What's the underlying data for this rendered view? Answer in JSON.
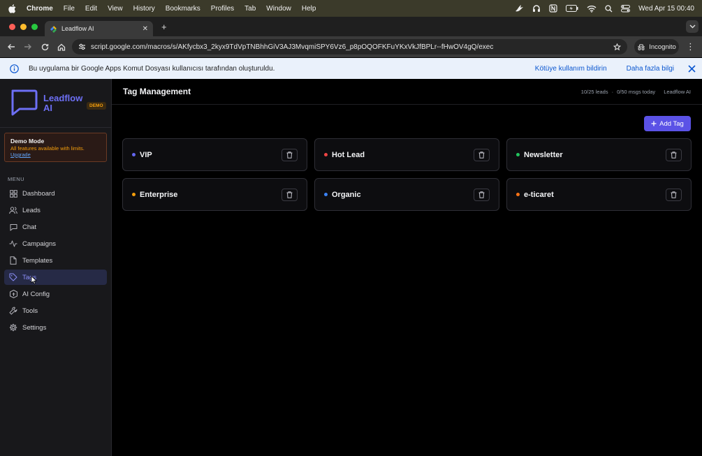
{
  "menubar": {
    "app": "Chrome",
    "items": [
      "File",
      "Edit",
      "View",
      "History",
      "Bookmarks",
      "Profiles",
      "Tab",
      "Window",
      "Help"
    ],
    "clock": "Wed Apr 15  00:40"
  },
  "browser": {
    "tab_title": "Leadflow AI",
    "url": "script.google.com/macros/s/AKfycbx3_2kyx9TdVpTNBhhGiV3AJ3MvqmiSPY6Vz6_p8pOQOFKFuYKxVkJfBPLr--fHwOV4gQ/exec",
    "incognito_label": "Incognito"
  },
  "infobar": {
    "message": "Bu uygulama bir Google Apps Komut Dosyası kullanıcısı tarafından oluşturuldu.",
    "report_link": "Kötüye kullanım bildirin",
    "more_link": "Daha fazla bilgi"
  },
  "sidebar": {
    "brand": "Leadflow AI",
    "badge": "DEMO",
    "demo": {
      "title": "Demo Mode",
      "desc": "All features available with limits.",
      "link": "Upgrade"
    },
    "menu_label": "MENU",
    "items": [
      {
        "label": "Dashboard",
        "icon": "grid-icon"
      },
      {
        "label": "Leads",
        "icon": "users-icon"
      },
      {
        "label": "Chat",
        "icon": "chat-icon"
      },
      {
        "label": "Campaigns",
        "icon": "activity-icon"
      },
      {
        "label": "Templates",
        "icon": "file-icon"
      },
      {
        "label": "Tags",
        "icon": "tag-icon",
        "active": true
      },
      {
        "label": "AI Config",
        "icon": "cpu-icon"
      },
      {
        "label": "Tools",
        "icon": "wrench-icon"
      },
      {
        "label": "Settings",
        "icon": "gear-icon"
      }
    ]
  },
  "header": {
    "title": "Tag Management",
    "stats_leads": "10/25 leads",
    "stats_msgs": "0/50 msgs today",
    "app_name": "Leadflow AI"
  },
  "actions": {
    "add_tag": "Add Tag"
  },
  "tags": [
    {
      "name": "VIP",
      "color": "#6366f1"
    },
    {
      "name": "Hot Lead",
      "color": "#ef4444"
    },
    {
      "name": "Newsletter",
      "color": "#22c55e"
    },
    {
      "name": "Enterprise",
      "color": "#f59e0b"
    },
    {
      "name": "Organic",
      "color": "#3b82f6"
    },
    {
      "name": "e-ticaret",
      "color": "#f97316"
    }
  ],
  "colors": {
    "accent": "#5b52e6",
    "sidebar_bg": "#18181b",
    "main_bg": "#000000"
  }
}
